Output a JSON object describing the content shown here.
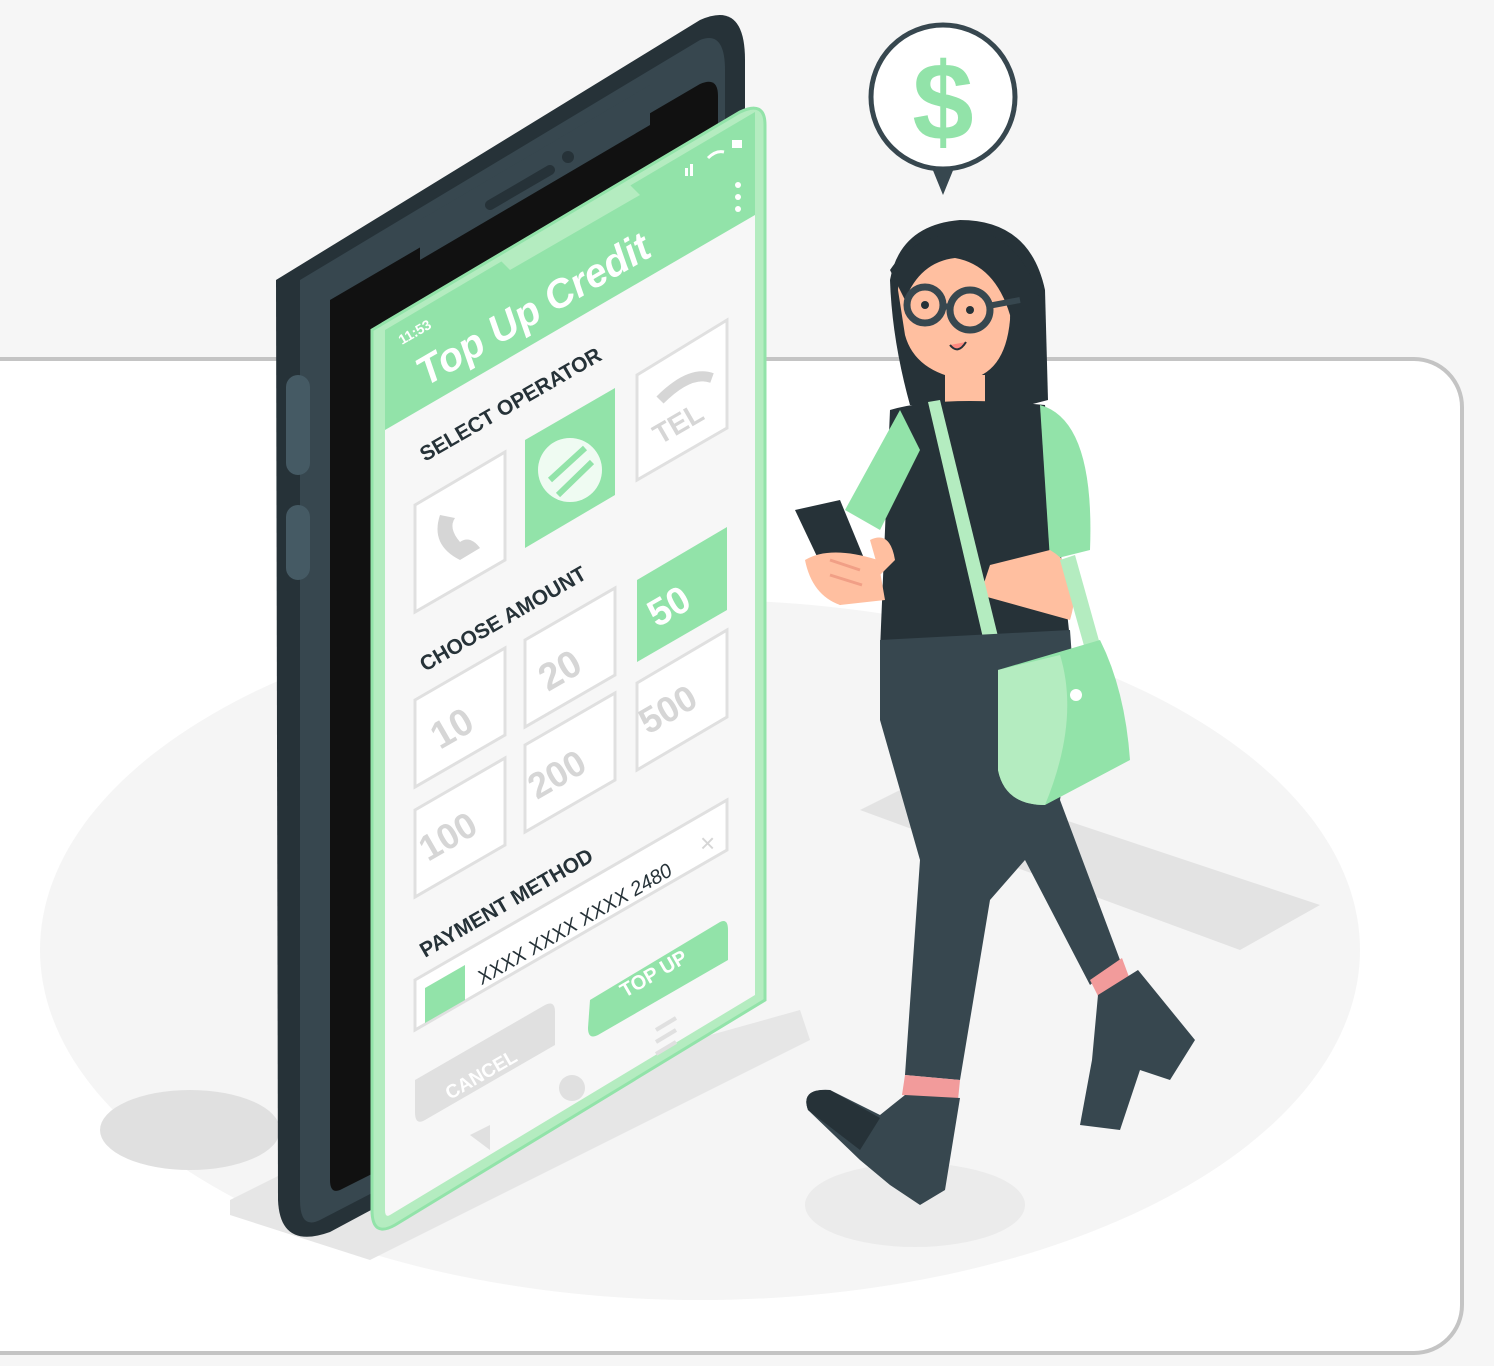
{
  "screen": {
    "status_time": "11:53",
    "title": "Top Up Credit",
    "select_operator_label": "SELECT OPERATOR",
    "operators": [
      {
        "name": "phone-operator",
        "icon": "phone-icon"
      },
      {
        "name": "arrows-operator",
        "icon": "exchange-arrows-icon",
        "selected": true
      },
      {
        "name": "tel-operator",
        "icon": "tel-icon",
        "text": "TEL"
      }
    ],
    "choose_amount_label": "CHOOSE AMOUNT",
    "amounts": [
      "20",
      "50",
      "10",
      "500",
      "200",
      "100"
    ],
    "selected_amount": "50",
    "payment_method_label": "PAYMENT METHOD",
    "card_number": "XXXX XXXX XXXX 2480",
    "clear_symbol": "×",
    "top_up_label": "TOP UP",
    "cancel_label": "CANCEL"
  },
  "speech_bubble": {
    "symbol": "$"
  },
  "colors": {
    "accent": "#92e3a9",
    "accent_light": "#b4ecc0",
    "dark": "#263238",
    "phone_body": "#37474f",
    "skin": "#ffbfa0",
    "sock": "#f29b9b"
  }
}
